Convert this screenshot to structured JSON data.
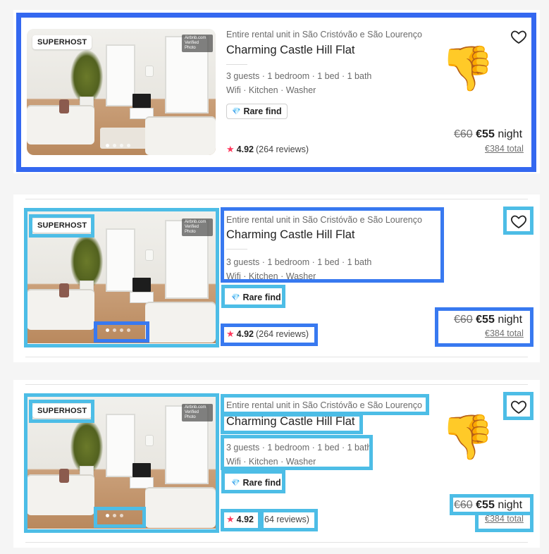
{
  "listing": {
    "badge": "SUPERHOST",
    "watermark": "Airbnb.com Verified Photo",
    "subtitle": "Entire rental unit in São Cristóvão e São Lourenço",
    "title": "Charming Castle Hill Flat",
    "details_line1": "3 guests · 1 bedroom · 1 bed · 1 bath",
    "details_line2": "Wifi · Kitchen · Washer",
    "rare_find": "Rare find",
    "rating": "4.92",
    "reviews_full": "(264 reviews)",
    "reviews_cropped": "64 reviews)",
    "old_price": "€60",
    "new_price": "€55",
    "price_unit": "night",
    "total": "€384 total"
  },
  "icons": {
    "heart": "heart-icon",
    "star": "star-icon",
    "diamond": "diamond-icon",
    "thumbs_down": "thumbs-down-icon"
  },
  "colors": {
    "annotation_blue": "#3879f0",
    "annotation_cyan": "#4dbde6",
    "star": "#ff385c"
  }
}
